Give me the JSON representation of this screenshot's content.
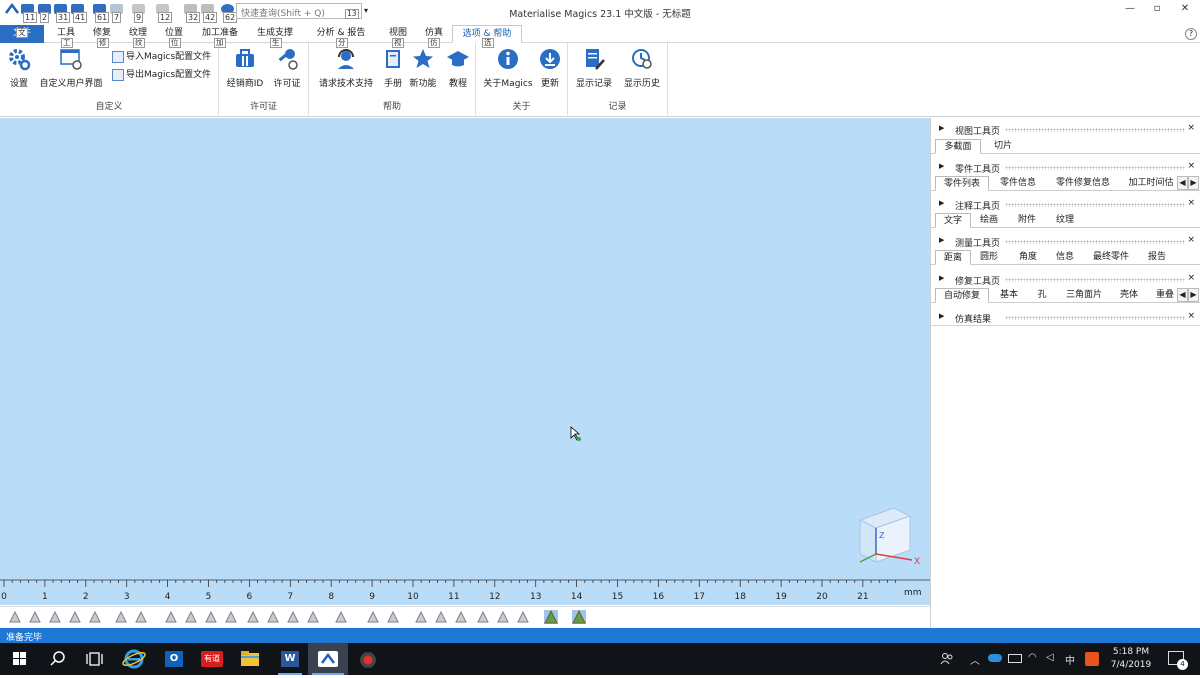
{
  "window": {
    "title": "Materialise Magics 23.1 中文版 - 无标题",
    "controls": [
      "—",
      "▫",
      "✕"
    ],
    "help": "?"
  },
  "quick_access": {
    "key_tips": [
      "11",
      "2",
      "31",
      "41",
      "61",
      "7",
      "9",
      "12",
      "32",
      "42",
      "62",
      "13"
    ],
    "search_placeholder": "快速查询(Shift + Q)",
    "more": "▾"
  },
  "ribbon_tabs": [
    {
      "label": "文件",
      "tip": "文"
    },
    {
      "label": "工具",
      "tip": "工"
    },
    {
      "label": "修复",
      "tip": "修"
    },
    {
      "label": "纹理",
      "tip": "纹"
    },
    {
      "label": "位置",
      "tip": "位"
    },
    {
      "label": "加工准备",
      "tip": "加"
    },
    {
      "label": "生成支撑",
      "tip": "生"
    },
    {
      "label": "分析 & 报告",
      "tip": "分"
    },
    {
      "label": "视图",
      "tip": "视"
    },
    {
      "label": "仿真",
      "tip": "仿"
    },
    {
      "label": "选项 & 帮助",
      "tip": "选"
    }
  ],
  "ribbon": {
    "custom": {
      "settings": "设置",
      "custom_ui": "自定义用户界面",
      "import_cfg": "导入Magics配置文件",
      "export_cfg": "导出Magics配置文件",
      "group": "自定义"
    },
    "license": {
      "reseller_id": "经销商ID",
      "license": "许可证",
      "group": "许可证"
    },
    "help": {
      "tech_support": "请求技术支持",
      "manual": "手册",
      "new_features": "新功能",
      "tutorial": "教程",
      "group": "帮助"
    },
    "about": {
      "about_magics": "关于Magics",
      "update": "更新",
      "group": "关于"
    },
    "log": {
      "show_log": "显示记录",
      "show_history": "显示历史",
      "group": "记录"
    }
  },
  "right_panel": {
    "sections": [
      {
        "title": "视图工具页",
        "tabs": [
          "多截面",
          "切片"
        ]
      },
      {
        "title": "零件工具页",
        "tabs": [
          "零件列表",
          "零件信息",
          "零件修复信息",
          "加工时间估"
        ]
      },
      {
        "title": "注释工具页",
        "tabs": [
          "文字",
          "绘画",
          "附件",
          "纹理"
        ]
      },
      {
        "title": "测量工具页",
        "tabs": [
          "距离",
          "圆形",
          "角度",
          "信息",
          "最终零件",
          "报告"
        ]
      },
      {
        "title": "修复工具页",
        "tabs": [
          "自动修复",
          "基本",
          "孔",
          "三角面片",
          "壳体",
          "重叠"
        ]
      },
      {
        "title": "仿真结果",
        "tabs": []
      }
    ],
    "close": "×",
    "expand_arrow": "▶"
  },
  "viewport": {
    "background": "#b9dcf8",
    "axis_labels": {
      "z": "Z",
      "x": "X"
    }
  },
  "ruler": {
    "ticks": [
      "0",
      "1",
      "2",
      "3",
      "4",
      "5",
      "6",
      "7",
      "8",
      "9",
      "10",
      "11",
      "12",
      "13",
      "14",
      "15",
      "16",
      "17",
      "18",
      "19",
      "20",
      "21"
    ],
    "unit": "mm"
  },
  "status_bar": {
    "text": "准备完毕"
  },
  "taskbar": {
    "time": "5:18 PM",
    "date": "7/4/2019",
    "ime": "中",
    "notification_count": "4",
    "apps": [
      "windows-start",
      "search",
      "task-view",
      "internet-explorer",
      "outlook",
      "youdao",
      "file-explorer",
      "word",
      "magics",
      "recorder"
    ],
    "youdao_label": "有道",
    "outlook_label": "O",
    "word_label": "W"
  },
  "colors": {
    "accent": "#2a6dc4",
    "status_bar": "#1e77d2",
    "viewport": "#b9dcf8",
    "taskbar": "#101318"
  }
}
